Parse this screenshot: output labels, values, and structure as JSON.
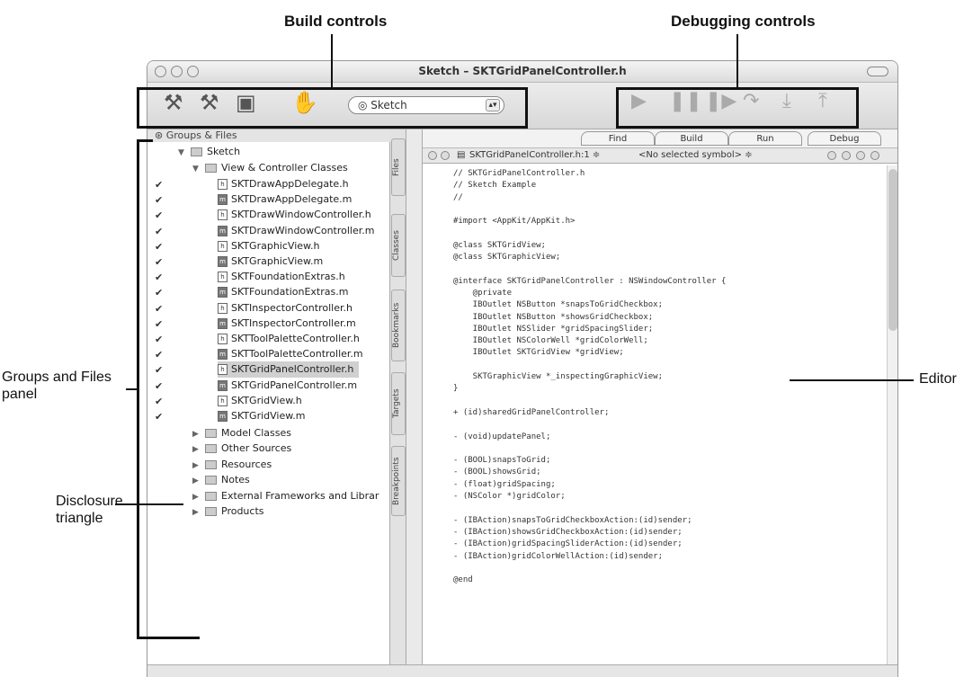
{
  "callouts": {
    "build": "Build controls",
    "debug": "Debugging controls",
    "groups": "Groups and Files\npanel",
    "disclosure": "Disclosure\ntriangle",
    "editor": "Editor"
  },
  "window": {
    "title": "Sketch – SKTGridPanelController.h"
  },
  "toolbar": {
    "icons": [
      "hammer-icon",
      "build-and-go-icon",
      "clean-icon",
      "stop-icon"
    ],
    "target_value": "Sketch",
    "debug_icons": [
      "run-icon",
      "pause-icon",
      "continue-icon",
      "step-over-icon",
      "step-into-icon",
      "step-out-icon"
    ]
  },
  "groups_files": {
    "header": "Groups & Files",
    "project": "Sketch",
    "expanded_group": "View & Controller Classes",
    "files": [
      {
        "name": "SKTDrawAppDelegate.h",
        "kind": "h"
      },
      {
        "name": "SKTDrawAppDelegate.m",
        "kind": "m"
      },
      {
        "name": "SKTDrawWindowController.h",
        "kind": "h"
      },
      {
        "name": "SKTDrawWindowController.m",
        "kind": "m"
      },
      {
        "name": "SKTGraphicView.h",
        "kind": "h"
      },
      {
        "name": "SKTGraphicView.m",
        "kind": "m"
      },
      {
        "name": "SKTFoundationExtras.h",
        "kind": "h"
      },
      {
        "name": "SKTFoundationExtras.m",
        "kind": "m"
      },
      {
        "name": "SKTInspectorController.h",
        "kind": "h"
      },
      {
        "name": "SKTInspectorController.m",
        "kind": "m"
      },
      {
        "name": "SKTToolPaletteController.h",
        "kind": "h"
      },
      {
        "name": "SKTToolPaletteController.m",
        "kind": "m"
      },
      {
        "name": "SKTGridPanelController.h",
        "kind": "h"
      },
      {
        "name": "SKTGridPanelController.m",
        "kind": "m"
      },
      {
        "name": "SKTGridView.h",
        "kind": "h"
      },
      {
        "name": "SKTGridView.m",
        "kind": "m"
      }
    ],
    "collapsed_groups": [
      "Model Classes",
      "Other Sources",
      "Resources",
      "Notes",
      "External Frameworks and Librar",
      "Products"
    ]
  },
  "side_tabs": [
    "Files",
    "Classes",
    "Bookmarks",
    "Targets",
    "Breakpoints"
  ],
  "editor_buttons": [
    "Find",
    "Build",
    "Run",
    "Debug"
  ],
  "navbar": {
    "file": "SKTGridPanelController.h:1 ≑",
    "symbol": "<No selected symbol> ≑"
  },
  "code_lines": [
    "// SKTGridPanelController.h",
    "// Sketch Example",
    "//",
    "",
    "#import <AppKit/AppKit.h>",
    "",
    "@class SKTGridView;",
    "@class SKTGraphicView;",
    "",
    "@interface SKTGridPanelController : NSWindowController {",
    "    @private",
    "    IBOutlet NSButton *snapsToGridCheckbox;",
    "    IBOutlet NSButton *showsGridCheckbox;",
    "    IBOutlet NSSlider *gridSpacingSlider;",
    "    IBOutlet NSColorWell *gridColorWell;",
    "    IBOutlet SKTGridView *gridView;",
    "",
    "    SKTGraphicView *_inspectingGraphicView;",
    "}",
    "",
    "+ (id)sharedGridPanelController;",
    "",
    "- (void)updatePanel;",
    "",
    "- (BOOL)snapsToGrid;",
    "- (BOOL)showsGrid;",
    "- (float)gridSpacing;",
    "- (NSColor *)gridColor;",
    "",
    "- (IBAction)snapsToGridCheckboxAction:(id)sender;",
    "- (IBAction)showsGridCheckboxAction:(id)sender;",
    "- (IBAction)gridSpacingSliderAction:(id)sender;",
    "- (IBAction)gridColorWellAction:(id)sender;",
    "",
    "@end"
  ]
}
